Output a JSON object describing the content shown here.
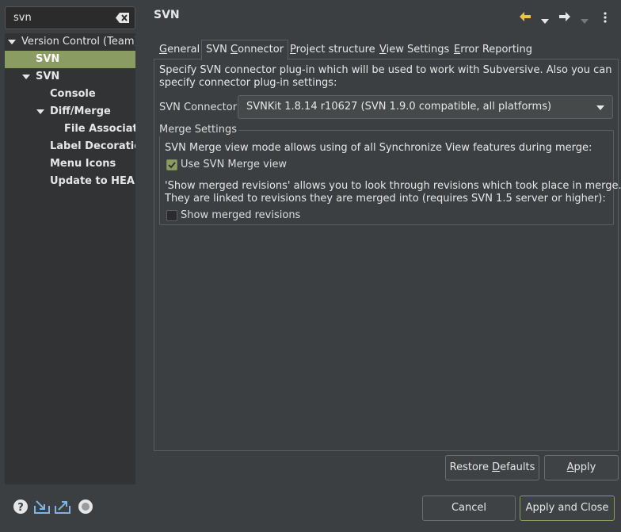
{
  "filter": {
    "value": "svn"
  },
  "tree": [
    {
      "label": "Version Control (Team)",
      "level": 0,
      "expanded": true,
      "bold": false,
      "selected": false
    },
    {
      "label": "SVN",
      "level": 1,
      "expanded": false,
      "bold": true,
      "selected": true
    },
    {
      "label": "SVN",
      "level": 1,
      "expanded": true,
      "bold": true,
      "selected": false
    },
    {
      "label": "Console",
      "level": 2,
      "expanded": false,
      "bold": true,
      "selected": false
    },
    {
      "label": "Diff/Merge",
      "level": 2,
      "expanded": true,
      "bold": true,
      "selected": false
    },
    {
      "label": "File Associatio",
      "level": 3,
      "expanded": false,
      "bold": true,
      "selected": false
    },
    {
      "label": "Label Decoration",
      "level": 2,
      "expanded": false,
      "bold": true,
      "selected": false
    },
    {
      "label": "Menu Icons",
      "level": 2,
      "expanded": false,
      "bold": true,
      "selected": false
    },
    {
      "label": "Update to HEAD",
      "level": 2,
      "expanded": false,
      "bold": true,
      "selected": false
    }
  ],
  "page": {
    "title": "SVN"
  },
  "tabs": [
    {
      "label": "General",
      "mnemonic": "G",
      "active": false
    },
    {
      "label": "SVN Connector",
      "mnemonic": "C",
      "active": true
    },
    {
      "label": "Project structure",
      "mnemonic": "P",
      "active": false
    },
    {
      "label": "View Settings",
      "mnemonic": "V",
      "active": false
    },
    {
      "label": "Error Reporting",
      "mnemonic": "E",
      "active": false
    }
  ],
  "connector": {
    "description": "Specify SVN connector plug-in which will be used to work with Subversive. Also you can specify connector plug-in settings:",
    "label": "SVN Connector:",
    "selected": "SVNKit 1.8.14 r10627 (SVN 1.9.0 compatible, all platforms)"
  },
  "merge": {
    "group_title": "Merge Settings",
    "merge_view_desc": "SVN Merge view mode allows using of all Synchronize View features during merge:",
    "merge_view_label": "Use SVN Merge view",
    "merge_view_checked": true,
    "merged_revisions_desc_1": "'Show merged revisions' allows you to look through revisions which took place in merge.",
    "merged_revisions_desc_2": "They are linked to revisions they are merged into (requires SVN 1.5 server or higher):",
    "merged_revisions_label": "Show merged revisions",
    "merged_revisions_checked": false
  },
  "buttons": {
    "restore_pre": "Restore ",
    "restore_mn": "D",
    "restore_post": "efaults",
    "apply_mn": "A",
    "apply_post": "pply",
    "cancel": "Cancel",
    "apply_close": "Apply and Close"
  },
  "icons": {
    "help": "help-icon",
    "import": "import-icon",
    "export": "export-icon",
    "oomph": "preference-recorder-icon",
    "back": "back-arrow-icon",
    "forward": "forward-arrow-icon"
  },
  "colors": {
    "accent": "#8a9c62",
    "background": "#3c3f41",
    "tree_background": "#313335"
  }
}
